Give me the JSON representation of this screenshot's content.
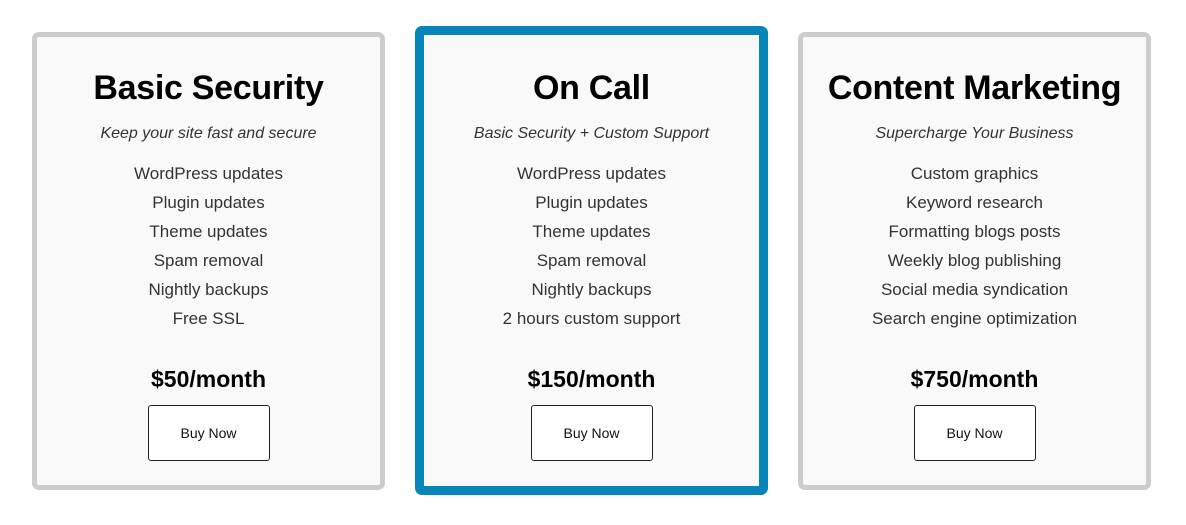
{
  "accent_color": "#0686b8",
  "plans": [
    {
      "title": "Basic Security",
      "subtitle": "Keep your site fast and secure",
      "features": [
        "WordPress updates",
        "Plugin updates",
        "Theme updates",
        "Spam removal",
        "Nightly backups",
        "Free SSL"
      ],
      "price": "$50/month",
      "button_label": "Buy Now",
      "highlighted": false
    },
    {
      "title": "On Call",
      "subtitle": "Basic Security + Custom Support",
      "features": [
        "WordPress updates",
        "Plugin updates",
        "Theme updates",
        "Spam removal",
        "Nightly backups",
        "2 hours custom support"
      ],
      "price": "$150/month",
      "button_label": "Buy Now",
      "highlighted": true
    },
    {
      "title": "Content Marketing",
      "subtitle": "Supercharge Your Business",
      "features": [
        "Custom graphics",
        "Keyword research",
        "Formatting blogs posts",
        "Weekly blog publishing",
        "Social media syndication",
        "Search engine optimization"
      ],
      "price": "$750/month",
      "button_label": "Buy Now",
      "highlighted": false
    }
  ]
}
